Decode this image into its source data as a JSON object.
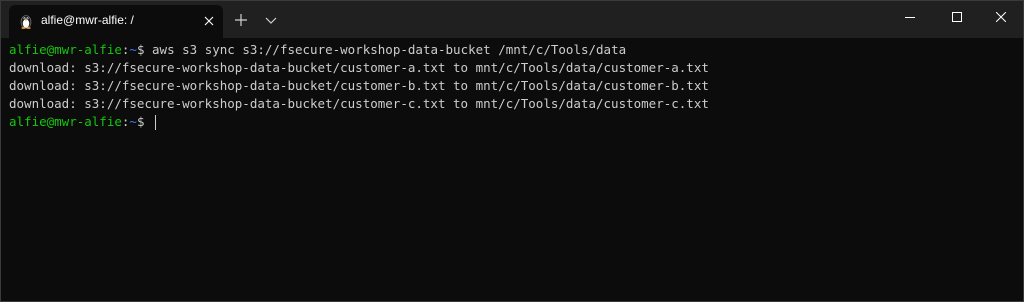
{
  "tab": {
    "title": "alfie@mwr-alfie: /",
    "icon": "linux-penguin-icon"
  },
  "titlebar": {
    "new_tab_icon": "plus-icon",
    "dropdown_icon": "chevron-down-icon",
    "minimize_icon": "minimize-icon",
    "maximize_icon": "maximize-icon",
    "close_icon": "close-icon"
  },
  "terminal": {
    "command_line": {
      "user_host": "alfie@mwr-alfie",
      "separator": ":",
      "path": "~",
      "symbol": "$ ",
      "command": "aws s3 sync s3://fsecure-workshop-data-bucket /mnt/c/Tools/data"
    },
    "output": [
      "download: s3://fsecure-workshop-data-bucket/customer-a.txt to mnt/c/Tools/data/customer-a.txt",
      "download: s3://fsecure-workshop-data-bucket/customer-b.txt to mnt/c/Tools/data/customer-b.txt",
      "download: s3://fsecure-workshop-data-bucket/customer-c.txt to mnt/c/Tools/data/customer-c.txt"
    ],
    "final_prompt": {
      "user_host": "alfie@mwr-alfie",
      "separator": ":",
      "path": "~",
      "symbol": "$ "
    }
  },
  "colors": {
    "background": "#0c0c0c",
    "titlebar": "#202020",
    "text": "#cccccc",
    "prompt_user": "#16c60c",
    "prompt_path": "#3b78ff"
  }
}
